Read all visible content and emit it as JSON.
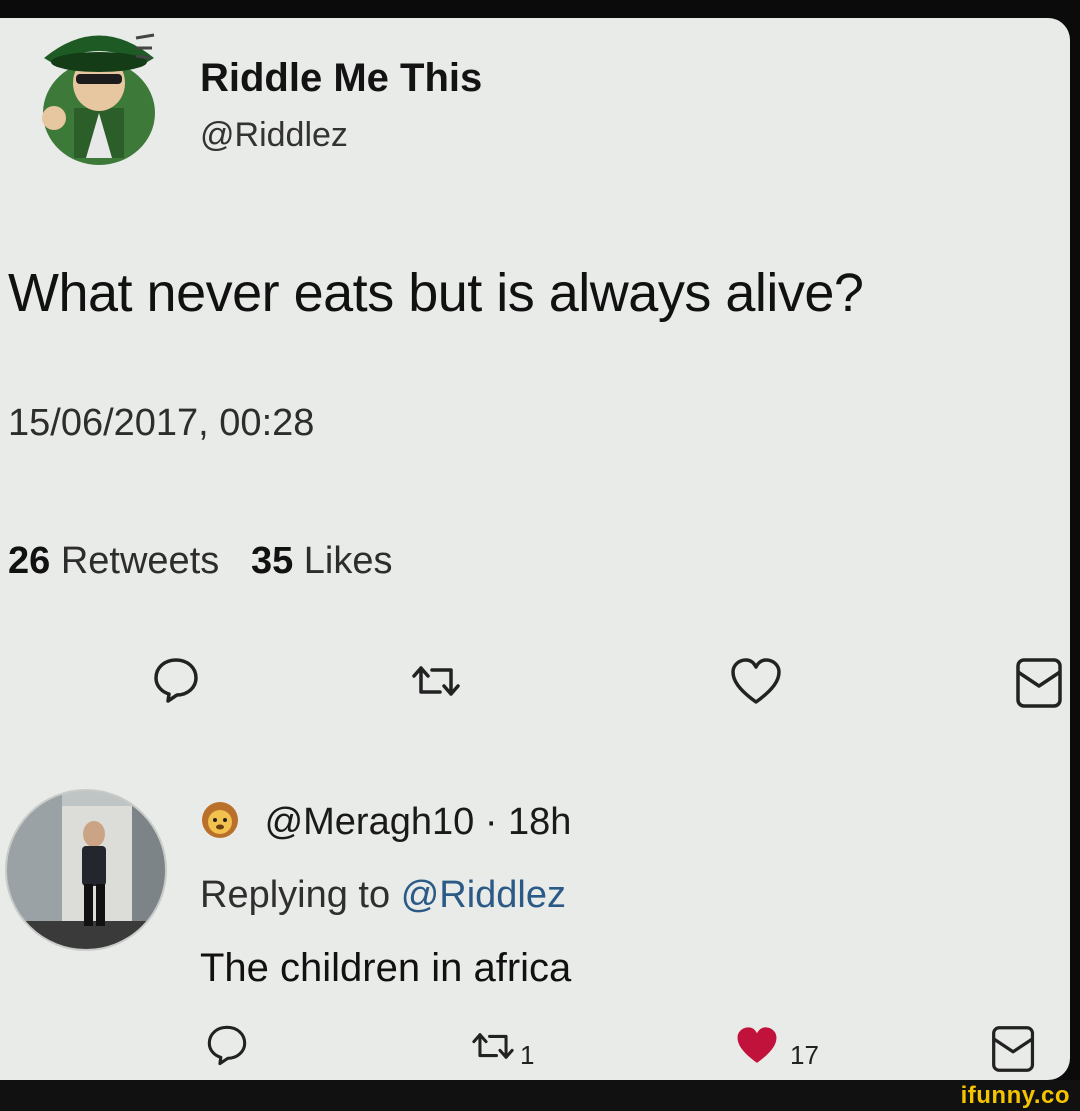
{
  "tweet": {
    "author_name": "Riddle Me This",
    "author_handle": "@Riddlez",
    "text": "What never eats but is always alive?",
    "timestamp": "15/06/2017, 00:28",
    "retweets_count": "26",
    "retweets_label": "Retweets",
    "likes_count": "35",
    "likes_label": "Likes",
    "actions": [
      "reply-icon",
      "retweet-icon",
      "like-icon",
      "message-icon"
    ]
  },
  "reply": {
    "handle": "@Meragh10",
    "separator": "·",
    "age": "18h",
    "replying_prefix": "Replying to",
    "replying_to": "@Riddlez",
    "text": "The children in africa",
    "retweets_count": "1",
    "likes_count": "17",
    "actions": [
      "reply-icon",
      "retweet-icon",
      "liked-heart-icon",
      "message-icon"
    ]
  },
  "watermark": "ifunny.co",
  "colors": {
    "card_bg": "#e9ebe8",
    "link": "#2b5a86",
    "liked_heart": "#c0123a",
    "brand": "#f5c400"
  }
}
